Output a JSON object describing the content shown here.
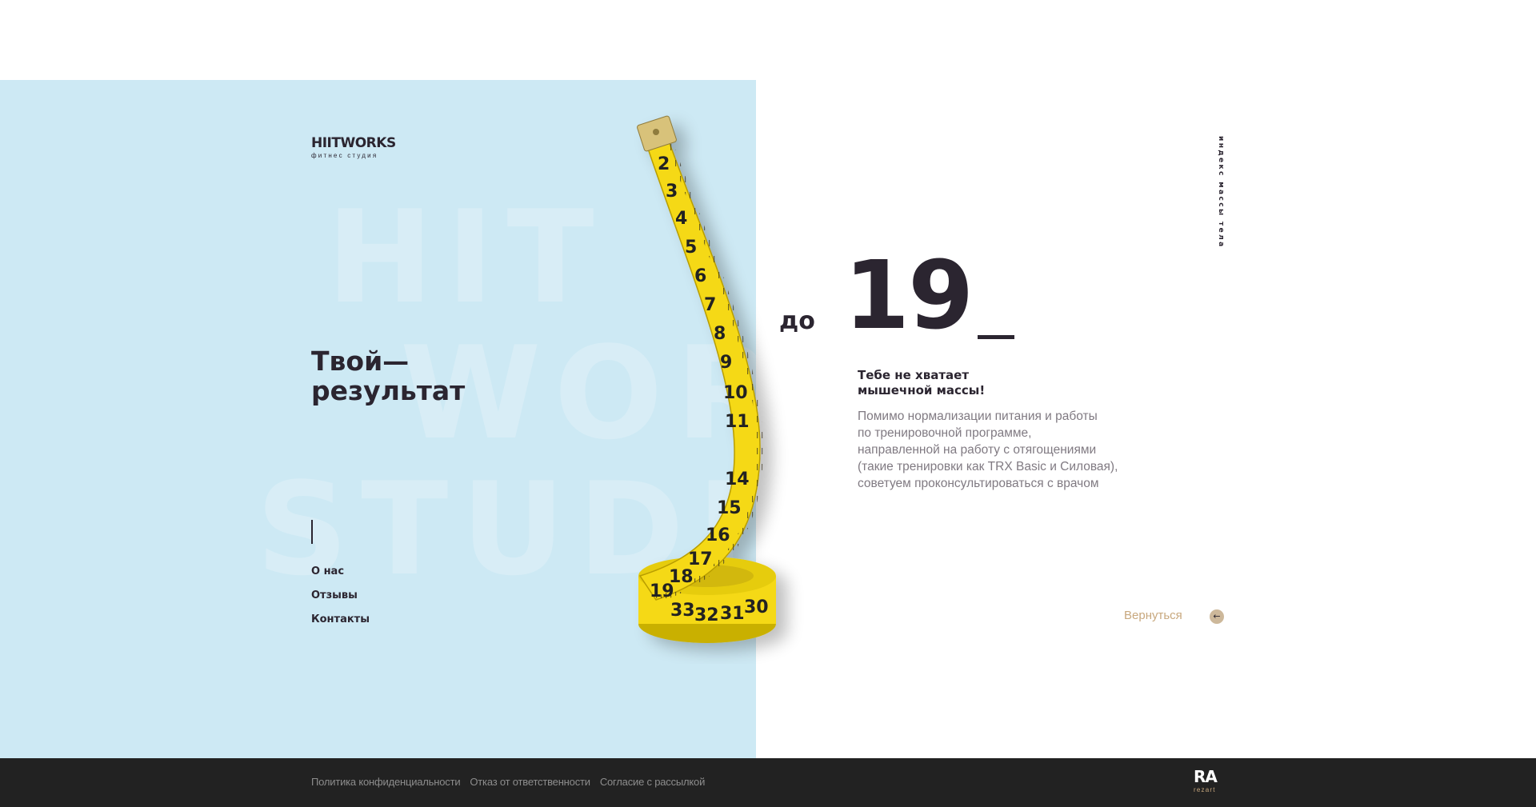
{
  "brand": {
    "name": "HIITWORKS",
    "tagline": "фитнес студия",
    "watermark_lines": [
      "HIT",
      "WOR",
      "STUDIO"
    ]
  },
  "hero": {
    "headline_line1": "Твой—",
    "headline_line2": "результат"
  },
  "nav": {
    "items": [
      {
        "label": "О нас"
      },
      {
        "label": "Отзывы"
      },
      {
        "label": "Контакты"
      }
    ]
  },
  "result": {
    "prefix": "до",
    "value": "19",
    "section_label": "индекс массы тела",
    "title_lines": [
      "Тебе не хватает",
      "мышечной массы!"
    ],
    "text_lines": [
      "Помимо нормализации питания и работы",
      "по тренировочной программе,",
      "направленной на работу с отягощениями",
      "(такие тренировки как TRX Basic и Силовая),",
      "советуем проконсультироваться с врачом"
    ],
    "back_label": "Вернуться",
    "back_icon": "arrow-left-icon"
  },
  "footer": {
    "links": [
      {
        "label": "Политика конфиденциальности"
      },
      {
        "label": "Отказ от ответственности"
      },
      {
        "label": "Согласие с рассылкой"
      }
    ],
    "developer_mark": "RA",
    "developer_name": "rezart"
  },
  "colors": {
    "panel": "#cde9f4",
    "text_dark": "#2b2530",
    "text_muted": "#807a82",
    "accent": "#c8a87e",
    "tape_yellow": "#f5d916",
    "footer_bg": "#222222"
  }
}
